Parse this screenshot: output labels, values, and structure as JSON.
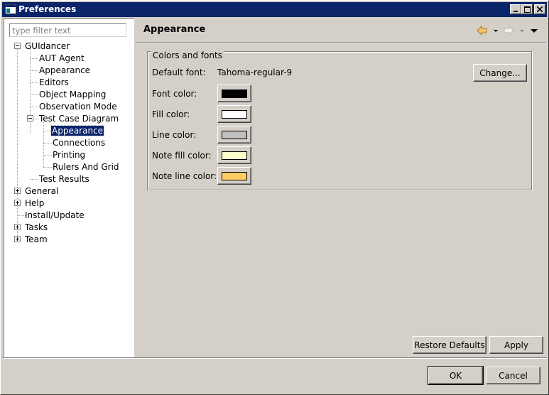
{
  "window": {
    "title": "Preferences"
  },
  "sidebar": {
    "filter_placeholder": "type filter text",
    "tree": [
      {
        "label": "GUIdancer"
      },
      {
        "label": "AUT Agent"
      },
      {
        "label": "Appearance"
      },
      {
        "label": "Editors"
      },
      {
        "label": "Object Mapping"
      },
      {
        "label": "Observation Mode"
      },
      {
        "label": "Test Case Diagram"
      },
      {
        "label": "Appearance",
        "selected": true
      },
      {
        "label": "Connections"
      },
      {
        "label": "Printing"
      },
      {
        "label": "Rulers And Grid"
      },
      {
        "label": "Test Results"
      },
      {
        "label": "General"
      },
      {
        "label": "Help"
      },
      {
        "label": "Install/Update"
      },
      {
        "label": "Tasks"
      },
      {
        "label": "Team"
      }
    ]
  },
  "page": {
    "title": "Appearance",
    "group_title": "Colors and fonts",
    "default_font_label": "Default font:",
    "default_font_value": "Tahoma-regular-9",
    "change_button": "Change...",
    "colors": [
      {
        "label": "Font color:",
        "swatch": "#000000"
      },
      {
        "label": "Fill color:",
        "swatch": "#ffffff"
      },
      {
        "label": "Line color:",
        "swatch": "#c0c0c0"
      },
      {
        "label": "Note fill color:",
        "swatch": "#ffffcc"
      },
      {
        "label": "Note line color:",
        "swatch": "#ffcc66"
      }
    ],
    "restore_defaults_button": "Restore Defaults",
    "apply_button": "Apply"
  },
  "dialog": {
    "ok_button": "OK",
    "cancel_button": "Cancel"
  },
  "icons": {
    "back": "back-arrow-icon",
    "forward": "forward-arrow-icon",
    "menu": "view-menu-icon"
  },
  "colors": {
    "titlebar": "#0a246a",
    "dialog_bg": "#d4d0c8",
    "selection": "#0a246a",
    "back_arrow": "#e8b04c"
  }
}
